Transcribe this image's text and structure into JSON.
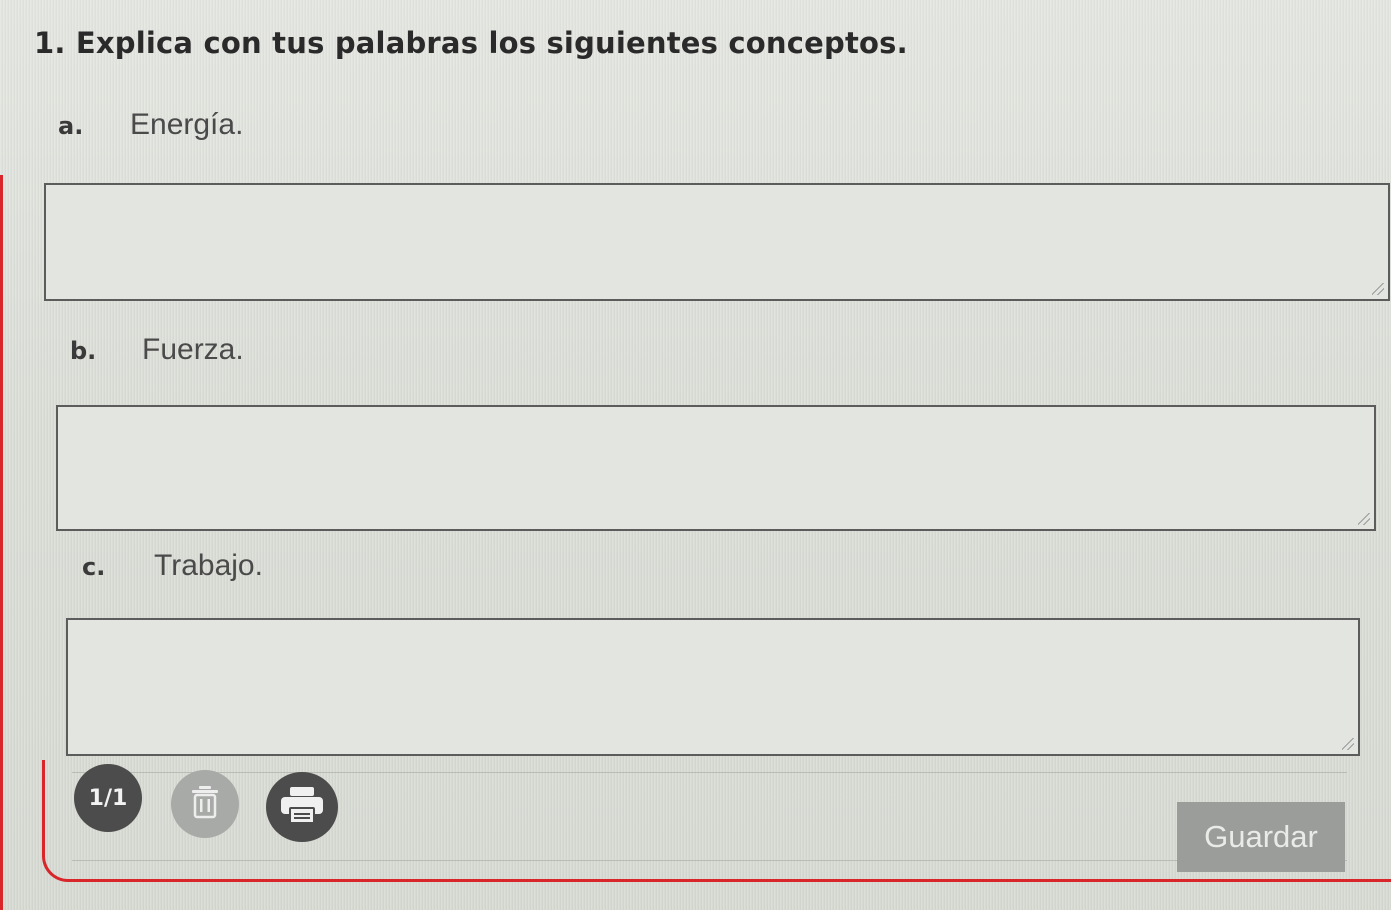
{
  "question": {
    "text": "1. Explica con tus palabras los siguientes conceptos."
  },
  "items": [
    {
      "letter": "a.",
      "term": "Energía."
    },
    {
      "letter": "b.",
      "term": "Fuerza."
    },
    {
      "letter": "c.",
      "term": "Trabajo."
    }
  ],
  "answers": [
    {
      "value": ""
    },
    {
      "value": ""
    },
    {
      "value": ""
    }
  ],
  "toolbar": {
    "page_counter": "1/1",
    "trash_icon": "trash-icon",
    "print_icon": "printer-icon",
    "save_label": "Guardar"
  },
  "colors": {
    "accent_red": "#d8262b",
    "dark_button": "#4b4c4b",
    "disabled_button": "#a7aaa6",
    "save_button": "#9b9d9a"
  }
}
